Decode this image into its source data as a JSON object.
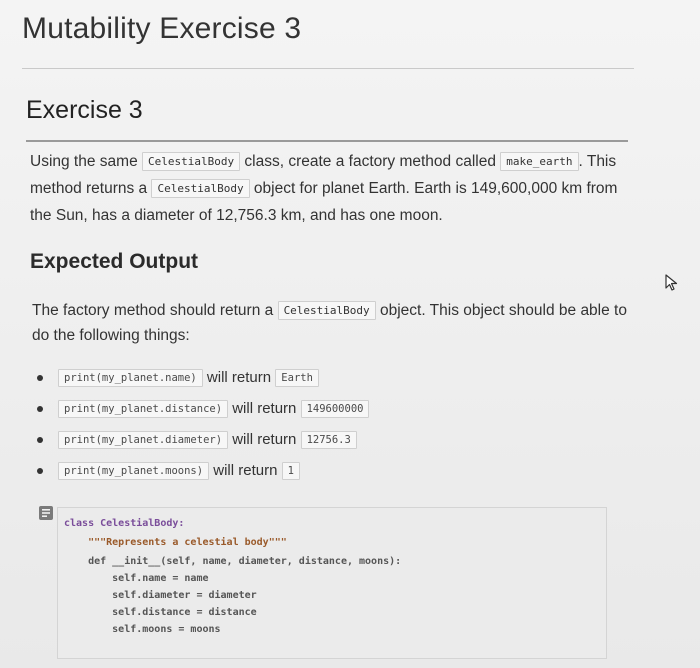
{
  "page": {
    "title": "Mutability Exercise 3"
  },
  "exercise": {
    "heading": "Exercise 3",
    "intro": {
      "t1": "Using the same ",
      "c1": "CelestialBody",
      "t2": " class, create a factory method called ",
      "c2": "make_earth",
      "t3": ". This method returns a ",
      "c3": "CelestialBody",
      "t4": " object for planet Earth. Earth is 149,600,000 km from the Sun, has a diameter of 12,756.3 km, and has one moon."
    }
  },
  "expected": {
    "heading": "Expected Output",
    "desc": {
      "t1": "The factory method should return a ",
      "c1": "CelestialBody",
      "t2": " object. This object should be able to do the following things:"
    },
    "items": [
      {
        "code": "print(my_planet.name)",
        "text": " will return ",
        "result": "Earth"
      },
      {
        "code": "print(my_planet.distance)",
        "text": " will return ",
        "result": "149600000"
      },
      {
        "code": "print(my_planet.diameter)",
        "text": " will return ",
        "result": "12756.3"
      },
      {
        "code": "print(my_planet.moons)",
        "text": " will return ",
        "result": "1"
      }
    ]
  },
  "code": {
    "lines": [
      "class CelestialBody:",
      "    \"\"\"Represents a celestial body\"\"\"",
      "    def __init__(self, name, diameter, distance, moons):",
      "        self.name = name",
      "        self.diameter = diameter",
      "        self.distance = distance",
      "        self.moons = moons"
    ]
  },
  "icons": {
    "cursor": "mouse-pointer-icon",
    "code": "code-block-icon"
  }
}
